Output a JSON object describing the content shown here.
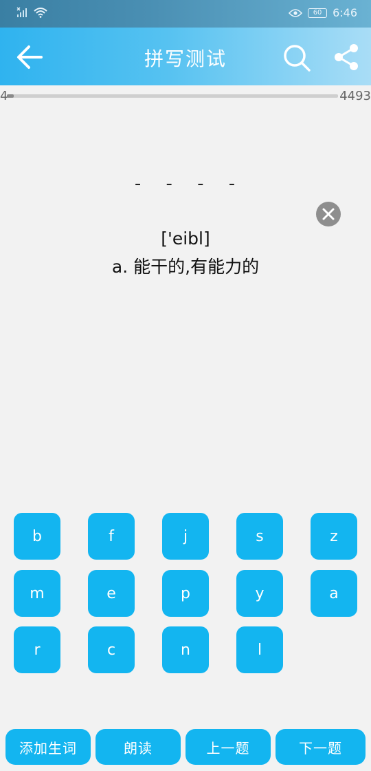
{
  "status_bar": {
    "time": "6:46",
    "battery": "60"
  },
  "app_bar": {
    "title": "拼写测试"
  },
  "progress": {
    "current": "4",
    "total": "4493",
    "fraction": 0.001
  },
  "word": {
    "blanks": "- - - -",
    "phonetic": "['eibl]",
    "meaning": "a. 能干的,有能力的"
  },
  "keyboard": {
    "keys": [
      "b",
      "f",
      "j",
      "s",
      "z",
      "m",
      "e",
      "p",
      "y",
      "a",
      "r",
      "c",
      "n",
      "l"
    ]
  },
  "bottom_actions": {
    "add_word": "添加生词",
    "read_aloud": "朗读",
    "previous": "上一题",
    "next": "下一题"
  },
  "colors": {
    "accent": "#13b5f0",
    "app_bar_start": "#2fb3ef",
    "app_bar_end": "#a9ddf6",
    "background": "#f2f2f2"
  }
}
